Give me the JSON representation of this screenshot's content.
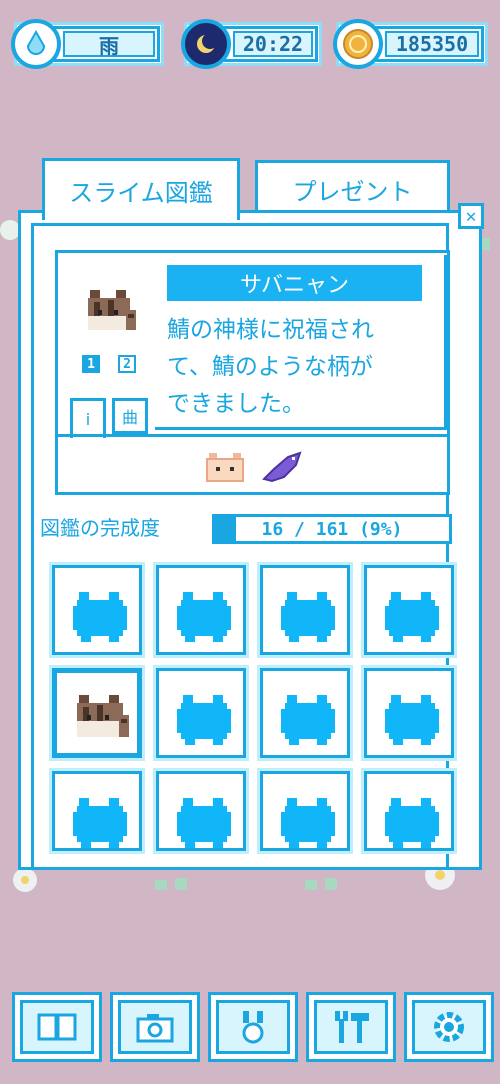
{
  "status": {
    "weather": {
      "icon": "raindrop-icon",
      "label": "雨"
    },
    "time": {
      "icon": "moon-icon",
      "label": "20:22"
    },
    "coins": {
      "icon": "coin-icon",
      "label": "185350"
    }
  },
  "tabs": {
    "encyclopedia": "スライム図鑑",
    "present": "プレゼント"
  },
  "close_label": "✕",
  "detail": {
    "name": "サバニャン",
    "description_lines": [
      "鯖の神様に祝福され",
      "て、鯖のような柄が",
      "できました。"
    ],
    "pages": [
      "1",
      "2"
    ],
    "mini_tabs": [
      "ⅰ",
      "曲"
    ]
  },
  "progress": {
    "label": "図鑑の完成度",
    "text": "16 / 161 (9%)",
    "fraction": 0.09
  },
  "grid": {
    "rows": 3,
    "cols": 4,
    "selected_index": 4
  },
  "nav": [
    "book-icon",
    "camera-icon",
    "medal-icon",
    "tools-icon",
    "gear-icon"
  ],
  "colors": {
    "accent": "#1aa6e0",
    "background": "#d1b6c5",
    "silhouette": "#11b6f8"
  }
}
